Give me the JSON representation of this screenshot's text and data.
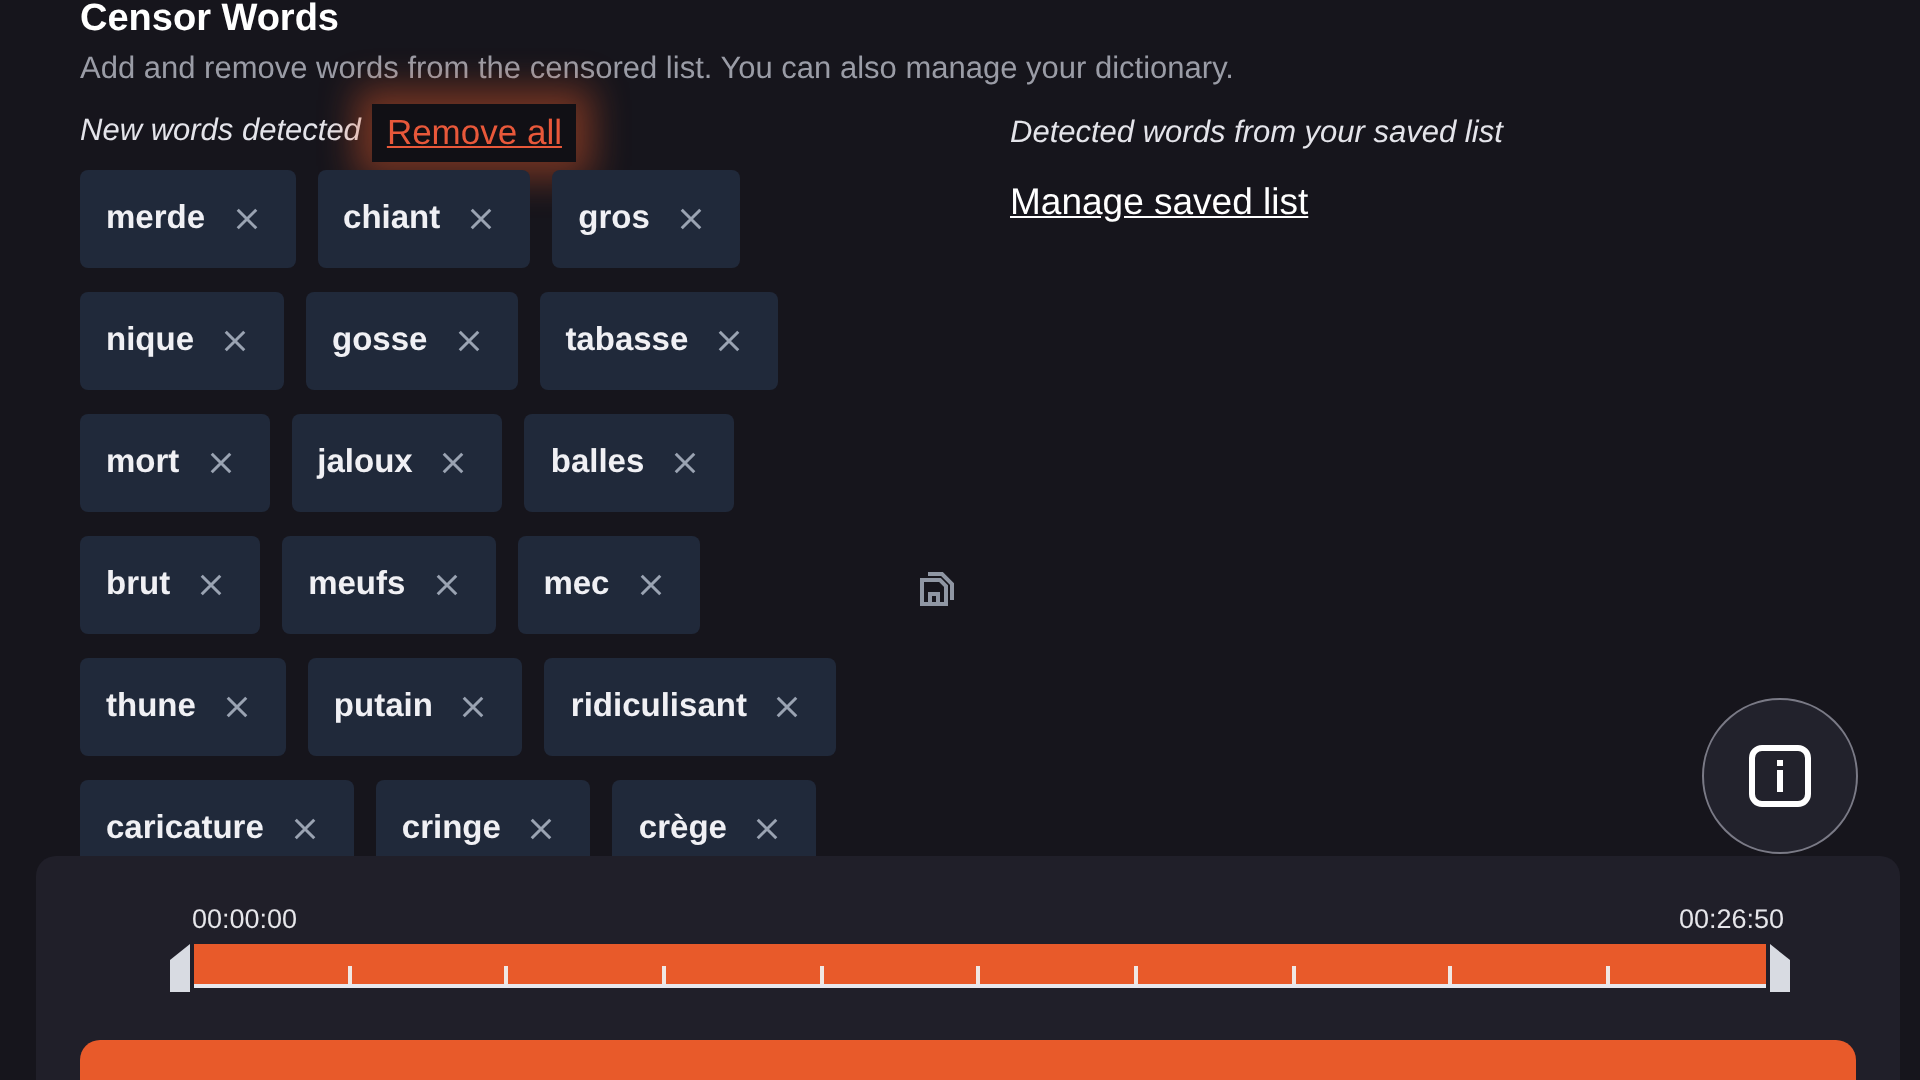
{
  "title": "Censor Words",
  "description": "Add and remove words from the censored list. You can also manage your dictionary.",
  "new_words": {
    "label": "New words detected",
    "remove_all": "Remove all",
    "tags": [
      [
        "merde",
        "chiant",
        "gros"
      ],
      [
        "nique",
        "gosse",
        "tabasse"
      ],
      [
        "mort",
        "jaloux",
        "balles"
      ],
      [
        "brut",
        "meufs",
        "mec"
      ],
      [
        "thune",
        "putain",
        "ridiculisant"
      ],
      [
        "caricature",
        "cringe",
        "crège"
      ]
    ]
  },
  "saved": {
    "label": "Detected words from your saved list",
    "link": "Manage saved list"
  },
  "timeline": {
    "start": "00:00:00",
    "end": "00:26:50"
  }
}
